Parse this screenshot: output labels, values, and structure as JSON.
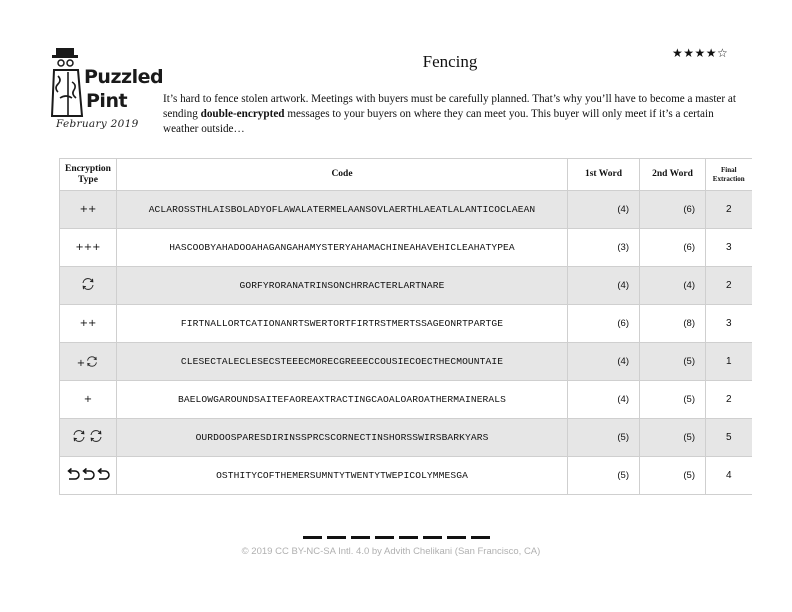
{
  "logo": {
    "brand_line1": "Puzzled",
    "brand_line2": "Pint",
    "month": "February 2019"
  },
  "puzzle": {
    "title": "Fencing",
    "rating_stars": "★★★★☆",
    "rating_value": 4,
    "rating_max": 5,
    "intro_part1": "It’s hard to fence stolen artwork. Meetings with buyers must be carefully planned. That’s why you’ll have to become a master at sending ",
    "intro_bold": "double-encrypted",
    "intro_part2": " messages to your buyers on where they can meet you. This buyer will only meet if it’s a certain weather outside…"
  },
  "table": {
    "headers": {
      "type": "Encryption Type",
      "code": "Code",
      "word1": "1st Word",
      "word2": "2nd Word",
      "final": "Final Extraction"
    },
    "rows": [
      {
        "type": "++",
        "type_icon": "plus-plus",
        "code": "ACLAROSSTHLAISBOLADYOFLAWALATERMELAANSOVLAERTHLAEATLALANTICOCLAEAN",
        "w1": "(4)",
        "w2": "(6)",
        "final": "2"
      },
      {
        "type": "+++",
        "type_icon": "plus-plus-plus",
        "code": "HASCOOBYAHADOOAHAGANGAHAMYSTERYAHAMACHINEAHAVEHICLEAHATYPEA",
        "w1": "(3)",
        "w2": "(6)",
        "final": "3"
      },
      {
        "type": "",
        "type_icon": "cycle-icon",
        "code": "GORFYRORANATRINSONCHRRACTERLARTNARE",
        "w1": "(4)",
        "w2": "(4)",
        "final": "2"
      },
      {
        "type": "++",
        "type_icon": "plus-plus",
        "code": "FIRTNALLORTCATIONANRTSWERTORTFIRTRSTMERTSSAGEONRTPARTGE",
        "w1": "(6)",
        "w2": "(8)",
        "final": "3"
      },
      {
        "type": "+",
        "type_icon": "plus-cycle-icon",
        "code": "CLESECTALECLESECSTEEECMORECGREEECCOUSIECOECTHECMOUNTAIE",
        "w1": "(4)",
        "w2": "(5)",
        "final": "1"
      },
      {
        "type": "+",
        "type_icon": "plus",
        "code": "BAELOWGAROUNDSAITEFAOREAXTRACTINGCAOALOAROATHERMAINERALS",
        "w1": "(4)",
        "w2": "(5)",
        "final": "2"
      },
      {
        "type": "",
        "type_icon": "double-cycle-icon",
        "code": "OURDOOSPARESDIRINSSPRCSCORNECTINSHORSSWIRSBARKYARS",
        "w1": "(5)",
        "w2": "(5)",
        "final": "5"
      },
      {
        "type": "",
        "type_icon": "triple-undo-icon",
        "code": "OSTHITYCOFTHEMERSUMNTYTWENTYTWEPICOLYMMESGA",
        "w1": "(5)",
        "w2": "(5)",
        "final": "4"
      }
    ]
  },
  "answer_blanks": 8,
  "footer": "© 2019 CC BY-NC-SA Intl. 4.0 by Advith Chelikani (San Francisco, CA)"
}
